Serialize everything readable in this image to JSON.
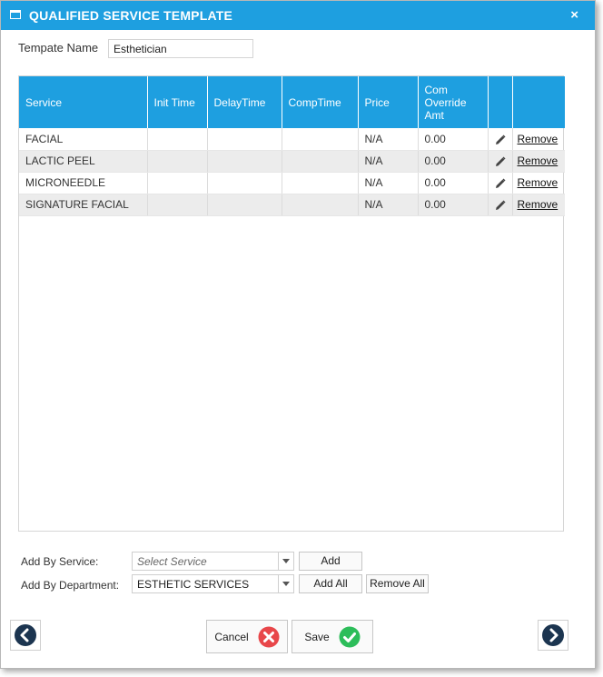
{
  "dialog": {
    "title": "QUALIFIED SERVICE TEMPLATE",
    "close_label": "×"
  },
  "template": {
    "label": "Tempate Name",
    "value": "Esthetician"
  },
  "grid": {
    "columns": [
      "Service",
      "Init Time",
      "DelayTime",
      "CompTime",
      "Price",
      "Com Override Amt",
      "",
      ""
    ],
    "rows": [
      {
        "service": "FACIAL",
        "init": "",
        "delay": "",
        "comp": "",
        "price": "N/A",
        "override": "0.00",
        "remove": "Remove"
      },
      {
        "service": "LACTIC PEEL",
        "init": "",
        "delay": "",
        "comp": "",
        "price": "N/A",
        "override": "0.00",
        "remove": "Remove"
      },
      {
        "service": "MICRONEEDLE",
        "init": "",
        "delay": "",
        "comp": "",
        "price": "N/A",
        "override": "0.00",
        "remove": "Remove"
      },
      {
        "service": "SIGNATURE FACIAL",
        "init": "",
        "delay": "",
        "comp": "",
        "price": "N/A",
        "override": "0.00",
        "remove": "Remove"
      }
    ]
  },
  "add_by_service": {
    "label": "Add By Service:",
    "placeholder": "Select Service",
    "button": "Add"
  },
  "add_by_department": {
    "label": "Add By Department:",
    "value": "ESTHETIC SERVICES",
    "add_all": "Add All",
    "remove_all": "Remove All"
  },
  "footer": {
    "cancel": "Cancel",
    "save": "Save"
  },
  "colors": {
    "header_blue": "#1e9fe0",
    "cancel_red": "#e8474a",
    "save_green": "#2dbd5a",
    "nav_dark": "#1c3550"
  }
}
